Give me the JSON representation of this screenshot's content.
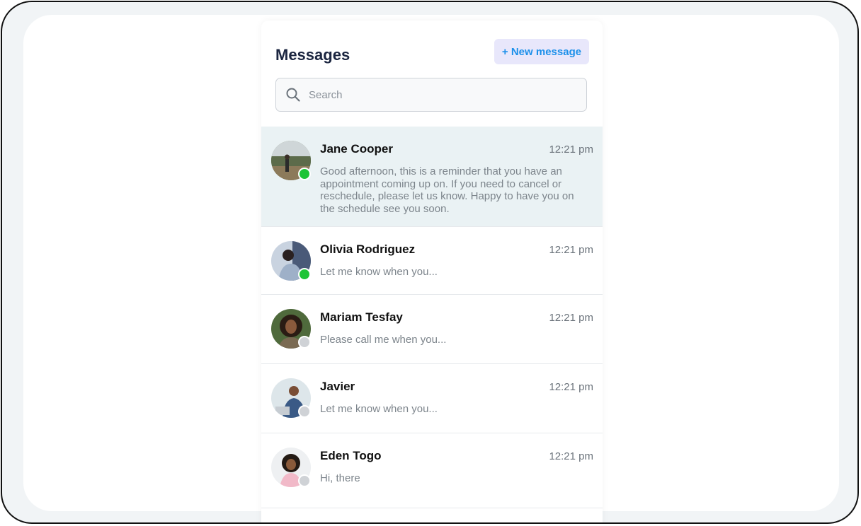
{
  "header": {
    "title": "Messages",
    "new_message_label": "+ New message"
  },
  "search": {
    "placeholder": "Search",
    "icon": "search-icon"
  },
  "colors": {
    "accent": "#1c90ea",
    "button_bg": "#e8e7fb",
    "active_row_bg": "#eaf2f4",
    "online": "#1ec436",
    "offline": "#cfd2d6"
  },
  "conversations": [
    {
      "name": "Jane Cooper",
      "time": "12:21 pm",
      "preview": "Good afternoon, this is a reminder that you have an appointment coming up on. If you need to cancel or reschedule, please let us know. Happy to have you on the schedule see you soon.",
      "status": "online",
      "active": true
    },
    {
      "name": "Olivia Rodriguez",
      "time": "12:21 pm",
      "preview": "Let me know when you...",
      "status": "online",
      "active": false
    },
    {
      "name": "Mariam Tesfay",
      "time": "12:21 pm",
      "preview": "Please call me when you...",
      "status": "offline",
      "active": false
    },
    {
      "name": "Javier",
      "time": "12:21 pm",
      "preview": "Let me know when you...",
      "status": "offline",
      "active": false
    },
    {
      "name": "Eden Togo",
      "time": "12:21 pm",
      "preview": "Hi, there",
      "status": "offline",
      "active": false
    }
  ]
}
